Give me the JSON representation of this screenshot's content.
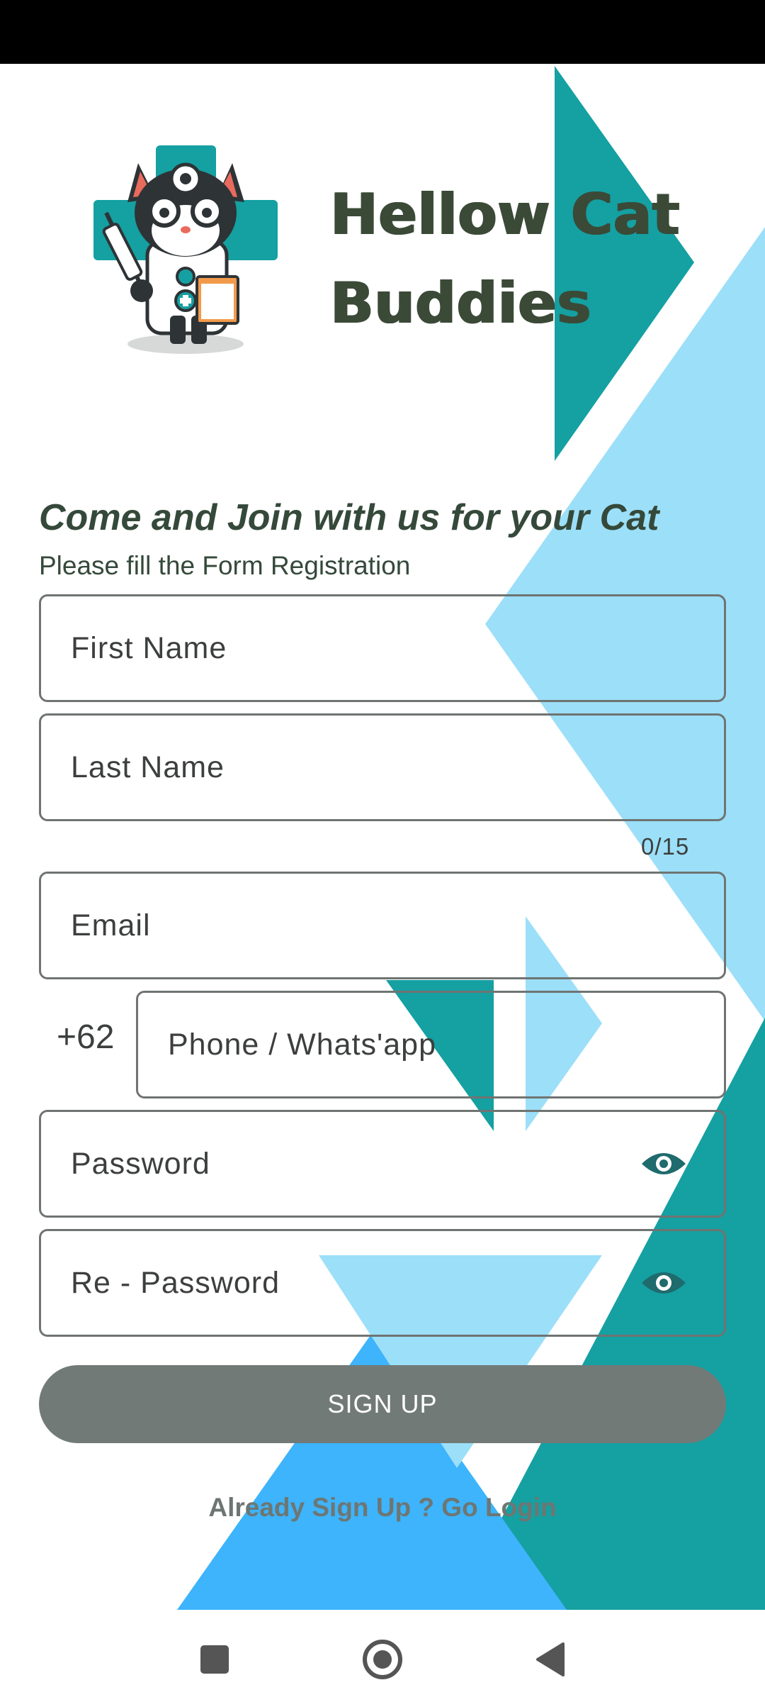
{
  "app": {
    "title_line1": "Hellow Cat",
    "title_line2": "Buddies"
  },
  "form": {
    "headline": "Come and Join with us for your Cat",
    "subtitle": "Please fill the Form Registration",
    "first_name_label": "First Name",
    "last_name_label": "Last Name",
    "last_name_counter": "0/15",
    "email_label": "Email",
    "country_code": "+62",
    "phone_label": "Phone / Whats'app",
    "password_label": "Password",
    "repassword_label": "Re - Password",
    "signup_label": "SIGN UP",
    "login_link": "Already Sign Up ? Go Login"
  },
  "icons": {
    "logo": "cat-doctor-logo",
    "password_toggle": "eye-icon",
    "nav_recents": "square-icon",
    "nav_home": "circle-icon",
    "nav_back": "triangle-back-icon"
  },
  "colors": {
    "teal": "#15a0a2",
    "light_blue": "#9cdff8",
    "bright_blue": "#3db4fb",
    "title_text": "#3a4a37",
    "button": "#727a78"
  }
}
